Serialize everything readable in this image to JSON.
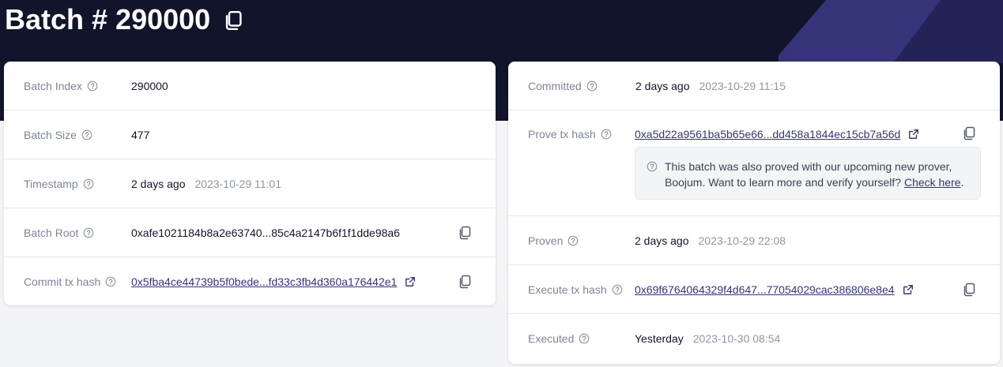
{
  "page": {
    "title": "Batch # 290000"
  },
  "left_card": {
    "rows": [
      {
        "label": "Batch Index",
        "value": "290000"
      },
      {
        "label": "Batch Size",
        "value": "477"
      },
      {
        "label": "Timestamp",
        "value": "2 days ago",
        "detail": "2023-10-29 11:01"
      },
      {
        "label": "Batch Root",
        "value": "0xafe1021184b8a2e63740...85c4a2147b6f1f1dde98a6"
      },
      {
        "label": "Commit tx hash",
        "value": "0x5fba4ce44739b5f0bede...fd33c3fb4d360a176442e1"
      }
    ]
  },
  "right_card": {
    "rows": [
      {
        "label": "Committed",
        "value": "2 days ago",
        "detail": "2023-10-29 11:15"
      },
      {
        "label": "Prove tx hash",
        "value": "0xa5d22a9561ba5b65e66...dd458a1844ec15cb7a56d"
      },
      {
        "label": "Proven",
        "value": "2 days ago",
        "detail": "2023-10-29 22:08"
      },
      {
        "label": "Execute tx hash",
        "value": "0x69f6764064329f4d647...77054029cac386806e8e4"
      },
      {
        "label": "Executed",
        "value": "Yesterday",
        "detail": "2023-10-30 08:54"
      }
    ],
    "notice": {
      "text_line1": "This batch was also proved with our upcoming new prover,",
      "text_line2": "Boojum. Want to learn more and verify yourself?",
      "link": "Check here",
      "suffix": "."
    }
  },
  "icons": {
    "help": "question-circle-icon",
    "copy": "copy-icon",
    "external": "external-link-icon"
  },
  "colors": {
    "hero_bg": "#11142b",
    "hero_accent": "#35347a",
    "link": "#35347a",
    "label": "#7d8497"
  }
}
